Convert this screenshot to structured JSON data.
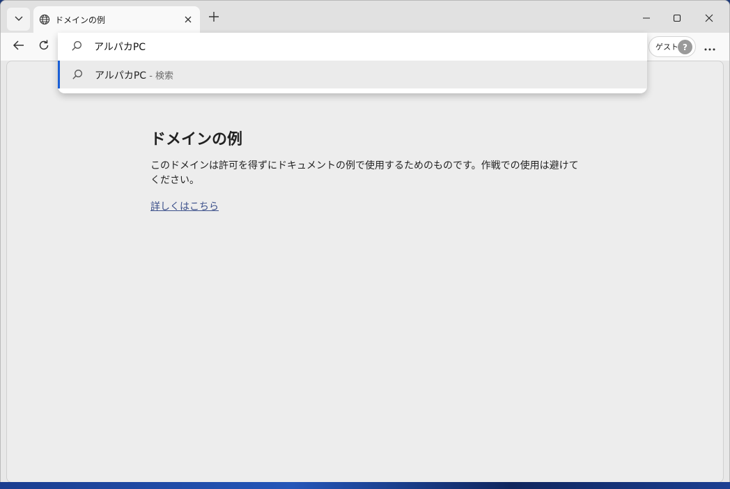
{
  "tab": {
    "title": "ドメインの例",
    "favicon": "globe-icon"
  },
  "window": {
    "minimize_icon": "minimize-icon",
    "maximize_icon": "maximize-icon",
    "close_icon": "close-icon"
  },
  "toolbar": {
    "profile_label": "ゲスト"
  },
  "omnibox": {
    "value": "アルパカPC",
    "suggestions": [
      {
        "text": "アルパカPC",
        "suffix": " - 検索"
      }
    ],
    "accent_color": "#1a5fd6"
  },
  "page": {
    "heading": "ドメインの例",
    "description": "このドメインは許可を得ずにドキュメントの例で使用するためのものです。作戦での使用は避けてください。",
    "link": "詳しくはこちら"
  }
}
